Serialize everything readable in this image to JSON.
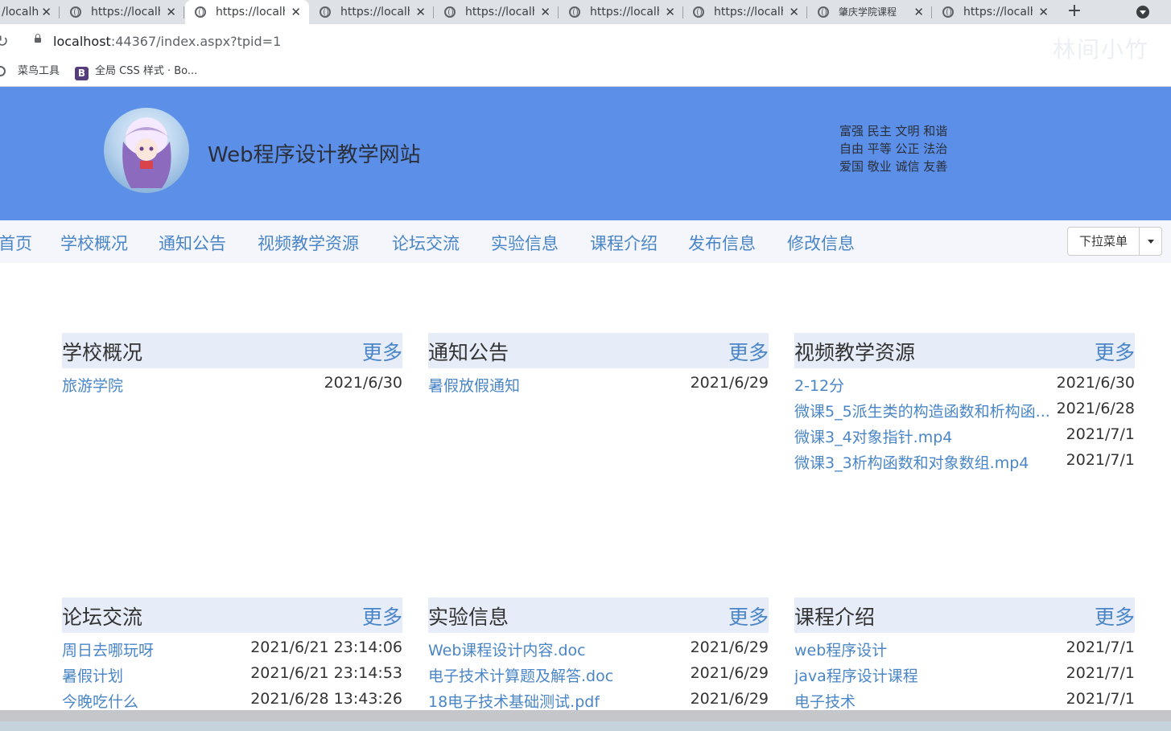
{
  "browser": {
    "tabs": [
      {
        "title": "/localh",
        "active": false
      },
      {
        "title": "https://localh",
        "active": false
      },
      {
        "title": "https://localh",
        "active": true
      },
      {
        "title": "https://localh",
        "active": false
      },
      {
        "title": "https://localh",
        "active": false
      },
      {
        "title": "https://localh",
        "active": false
      },
      {
        "title": "https://localh",
        "active": false
      },
      {
        "title": "肇庆学院课程",
        "active": false
      },
      {
        "title": "https://localh",
        "active": false
      }
    ],
    "url_host": "localhost",
    "url_path": ":44367/index.aspx?tpid=1",
    "watermark": "林间小竹",
    "bookmarks": [
      {
        "label": "菜鸟工具",
        "icon": "globe-icon"
      },
      {
        "label": "全局 CSS 样式 · Bo...",
        "icon": "bootstrap-icon",
        "badge": "B"
      }
    ]
  },
  "header": {
    "title": "Web程序设计教学网站",
    "values": [
      "富强 民主 文明 和谐",
      "自由 平等 公正 法治",
      "爱国 敬业 诚信 友善"
    ],
    "bg_color": "#5b8fe8"
  },
  "nav": {
    "items": [
      "首页",
      "学校概况",
      "通知公告",
      "视频教学资源",
      "论坛交流",
      "实验信息",
      "课程介绍",
      "发布信息",
      "修改信息"
    ],
    "dropdown_label": "下拉菜单"
  },
  "more_label": "更多",
  "panels": [
    {
      "title": "学校概况",
      "rows": [
        {
          "text": "旅游学院",
          "date": "2021/6/30"
        }
      ]
    },
    {
      "title": "通知公告",
      "rows": [
        {
          "text": "暑假放假通知",
          "date": "2021/6/29"
        }
      ]
    },
    {
      "title": "视频教学资源",
      "rows": [
        {
          "text": "2-12分",
          "date": "2021/6/30"
        },
        {
          "text": "微课5_5派生类的构造函数和析构函...",
          "date": "2021/6/28"
        },
        {
          "text": "微课3_4对象指针.mp4",
          "date": "2021/7/1"
        },
        {
          "text": "微课3_3析构函数和对象数组.mp4",
          "date": "2021/7/1"
        }
      ]
    },
    {
      "title": "论坛交流",
      "rows": [
        {
          "text": "周日去哪玩呀",
          "date": "2021/6/21 23:14:06"
        },
        {
          "text": "暑假计划",
          "date": "2021/6/21 23:14:53"
        },
        {
          "text": "今晚吃什么",
          "date": "2021/6/28 13:43:26"
        }
      ]
    },
    {
      "title": "实验信息",
      "rows": [
        {
          "text": "Web课程设计内容.doc",
          "date": "2021/6/29"
        },
        {
          "text": "电子技术计算题及解答.doc",
          "date": "2021/6/29"
        },
        {
          "text": "18电子技术基础测试.pdf",
          "date": "2021/6/29"
        }
      ]
    },
    {
      "title": "课程介绍",
      "rows": [
        {
          "text": "web程序设计",
          "date": "2021/7/1"
        },
        {
          "text": "java程序设计课程",
          "date": "2021/7/1"
        },
        {
          "text": "电子技术",
          "date": "2021/7/1"
        }
      ]
    }
  ]
}
